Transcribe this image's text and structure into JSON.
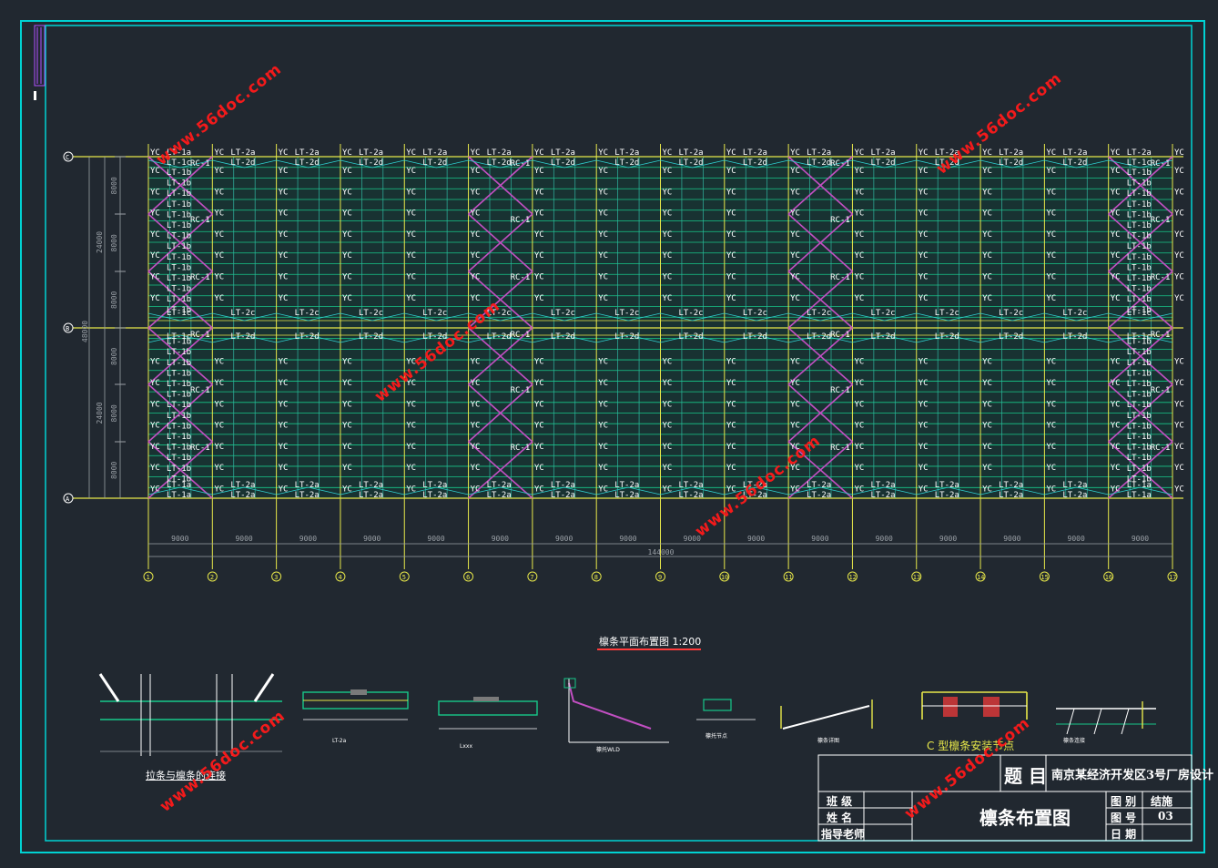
{
  "plan": {
    "top_purlin_labels": [
      "LT-1a",
      "LT-2a",
      "LT-2a",
      "LT-2a",
      "LT-2a",
      "LT-2a",
      "LT-2a",
      "LT-2a",
      "LT-2a",
      "LT-2a",
      "LT-2a",
      "LT-2a",
      "LT-2a",
      "LT-2a",
      "LT-2a",
      "LT-2a"
    ],
    "second_purlin_labels": [
      "LT-1c",
      "LT-2d",
      "LT-2d",
      "LT-2d",
      "LT-2d",
      "LT-2d",
      "LT-2d",
      "LT-2d",
      "LT-2d",
      "LT-2d",
      "LT-2d",
      "LT-2d",
      "LT-2d",
      "LT-2d",
      "LT-2d",
      "LT-1c"
    ],
    "ridge_labels": [
      "LT-1c",
      "LT-2c",
      "LT-2c",
      "LT-2c",
      "LT-2c",
      "LT-2c",
      "LT-2c",
      "LT-2c",
      "LT-2c",
      "LT-2c",
      "LT-2c",
      "LT-2c",
      "LT-2c",
      "LT-2c",
      "LT-2c",
      "LT-1c"
    ],
    "bottom_labels": [
      "LT-1a",
      "LT-2a",
      "LT-2a",
      "LT-2a",
      "LT-2a",
      "LT-2a",
      "LT-2a",
      "LT-2a",
      "LT-2a",
      "LT-2a",
      "LT-2a",
      "LT-2a",
      "LT-2a",
      "LT-2a",
      "LT-2a",
      "LT-1a"
    ],
    "end_bay_label": "LT-1b",
    "yc_label": "YC",
    "rc_label": "RC-1",
    "bay_dimensions": [
      "9000",
      "9000",
      "9000",
      "9000",
      "9000",
      "9000",
      "9000",
      "9000",
      "9000",
      "9000",
      "9000",
      "9000",
      "9000",
      "9000",
      "9000",
      "9000"
    ],
    "total_length": "144000",
    "span_half": "24000",
    "span_total": "48000",
    "sub_spans": [
      "8000",
      "8000",
      "8000",
      "8000",
      "8000",
      "8000"
    ],
    "column_axes": [
      "1",
      "2",
      "3",
      "4",
      "5",
      "6",
      "7",
      "8",
      "9",
      "10",
      "11",
      "12",
      "13",
      "14",
      "15",
      "16",
      "17"
    ],
    "row_axes": [
      "C",
      "B",
      "A"
    ],
    "title": "檩条平面布置图 1:200"
  },
  "details": {
    "tie_rod_caption": "拉条与檩条的连接",
    "c_section_caption": "C 型檩条安装节点",
    "small_captions": [
      "LT-2a",
      "Lxxx",
      "檩托WLD",
      "檩托节点",
      "檩条详图",
      "檩条连接"
    ]
  },
  "title_block": {
    "title_label": "题 目",
    "project_name": "南京某经济开发区3号厂房设计",
    "row_labels": [
      "班 级",
      "姓 名",
      "指导老师"
    ],
    "drawing_name": "檩条布置图",
    "right_labels": [
      "图 别",
      "图 号",
      "日 期"
    ],
    "right_values": [
      "结施",
      "03",
      ""
    ]
  },
  "watermark": "www.56doc.com",
  "colors": {
    "background": "#212830",
    "frame": "#00d2d2",
    "purlin": "#17c98a",
    "ridge": "#e8e84a",
    "bracing": "#c24fc2",
    "label": "#ffffff",
    "dimension": "#9aa0a6",
    "watermark": "#ff1a1a"
  }
}
